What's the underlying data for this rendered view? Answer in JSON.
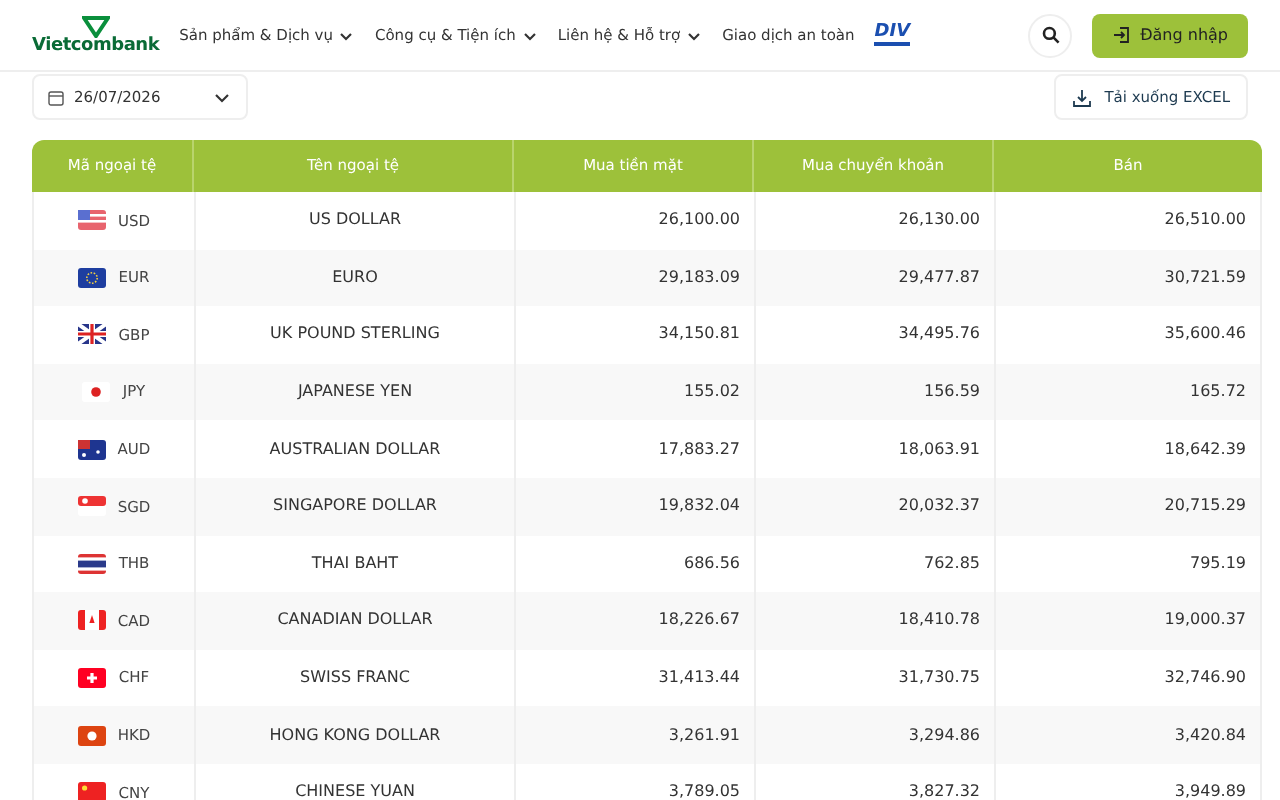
{
  "header": {
    "brand": "Vietcombank",
    "nav": [
      {
        "label": "Sản phẩm & Dịch vụ",
        "dropdown": true
      },
      {
        "label": "Công cụ & Tiện ích",
        "dropdown": true
      },
      {
        "label": "Liên hệ & Hỗ trợ",
        "dropdown": true
      },
      {
        "label": "Giao dịch an toàn",
        "dropdown": false
      }
    ],
    "partner_logo": "DIV",
    "login_button": "Đăng nhập"
  },
  "toolbar": {
    "date": "26/07/2026",
    "download_button": "Tải xuống EXCEL"
  },
  "table": {
    "columns": [
      "Mã ngoại tệ",
      "Tên ngoại tệ",
      "Mua tiền mặt",
      "Mua chuyển khoản",
      "Bán"
    ],
    "rows": [
      {
        "code": "USD",
        "name": "US DOLLAR",
        "cash_buy": "26,100.00",
        "transfer_buy": "26,130.00",
        "sell": "26,510.00"
      },
      {
        "code": "EUR",
        "name": "EURO",
        "cash_buy": "29,183.09",
        "transfer_buy": "29,477.87",
        "sell": "30,721.59"
      },
      {
        "code": "GBP",
        "name": "UK POUND STERLING",
        "cash_buy": "34,150.81",
        "transfer_buy": "34,495.76",
        "sell": "35,600.46"
      },
      {
        "code": "JPY",
        "name": "JAPANESE YEN",
        "cash_buy": "155.02",
        "transfer_buy": "156.59",
        "sell": "165.72"
      },
      {
        "code": "AUD",
        "name": "AUSTRALIAN DOLLAR",
        "cash_buy": "17,883.27",
        "transfer_buy": "18,063.91",
        "sell": "18,642.39"
      },
      {
        "code": "SGD",
        "name": "SINGAPORE DOLLAR",
        "cash_buy": "19,832.04",
        "transfer_buy": "20,032.37",
        "sell": "20,715.29"
      },
      {
        "code": "THB",
        "name": "THAI BAHT",
        "cash_buy": "686.56",
        "transfer_buy": "762.85",
        "sell": "795.19"
      },
      {
        "code": "CAD",
        "name": "CANADIAN DOLLAR",
        "cash_buy": "18,226.67",
        "transfer_buy": "18,410.78",
        "sell": "19,000.37"
      },
      {
        "code": "CHF",
        "name": "SWISS FRANC",
        "cash_buy": "31,413.44",
        "transfer_buy": "31,730.75",
        "sell": "32,746.90"
      },
      {
        "code": "HKD",
        "name": "HONG KONG DOLLAR",
        "cash_buy": "3,261.91",
        "transfer_buy": "3,294.86",
        "sell": "3,420.84"
      },
      {
        "code": "CNY",
        "name": "CHINESE YUAN",
        "cash_buy": "3,789.05",
        "transfer_buy": "3,827.32",
        "sell": "3,949.89"
      }
    ]
  }
}
